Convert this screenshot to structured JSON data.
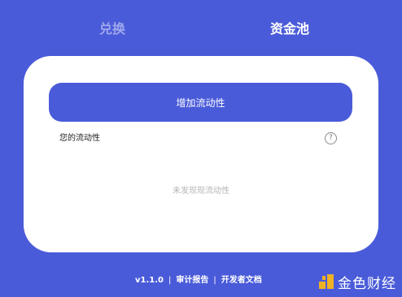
{
  "tabs": {
    "swap": "兑换",
    "pool": "资金池"
  },
  "card": {
    "add_liquidity_button": "增加流动性",
    "your_liquidity_label": "您的流动性",
    "help_symbol": "?",
    "empty_message": "未发现现流动性"
  },
  "footer": {
    "version": "v1.1.0",
    "separator": "|",
    "audit_report": "审计报告",
    "developer_docs": "开发者文档"
  },
  "watermark": {
    "text": "金色财经"
  },
  "colors": {
    "background": "#4a5bd9",
    "card": "#ffffff",
    "accent": "#4a5bd9",
    "inactive_tab": "#9fa8ec",
    "watermark_logo": "#f0b224"
  }
}
